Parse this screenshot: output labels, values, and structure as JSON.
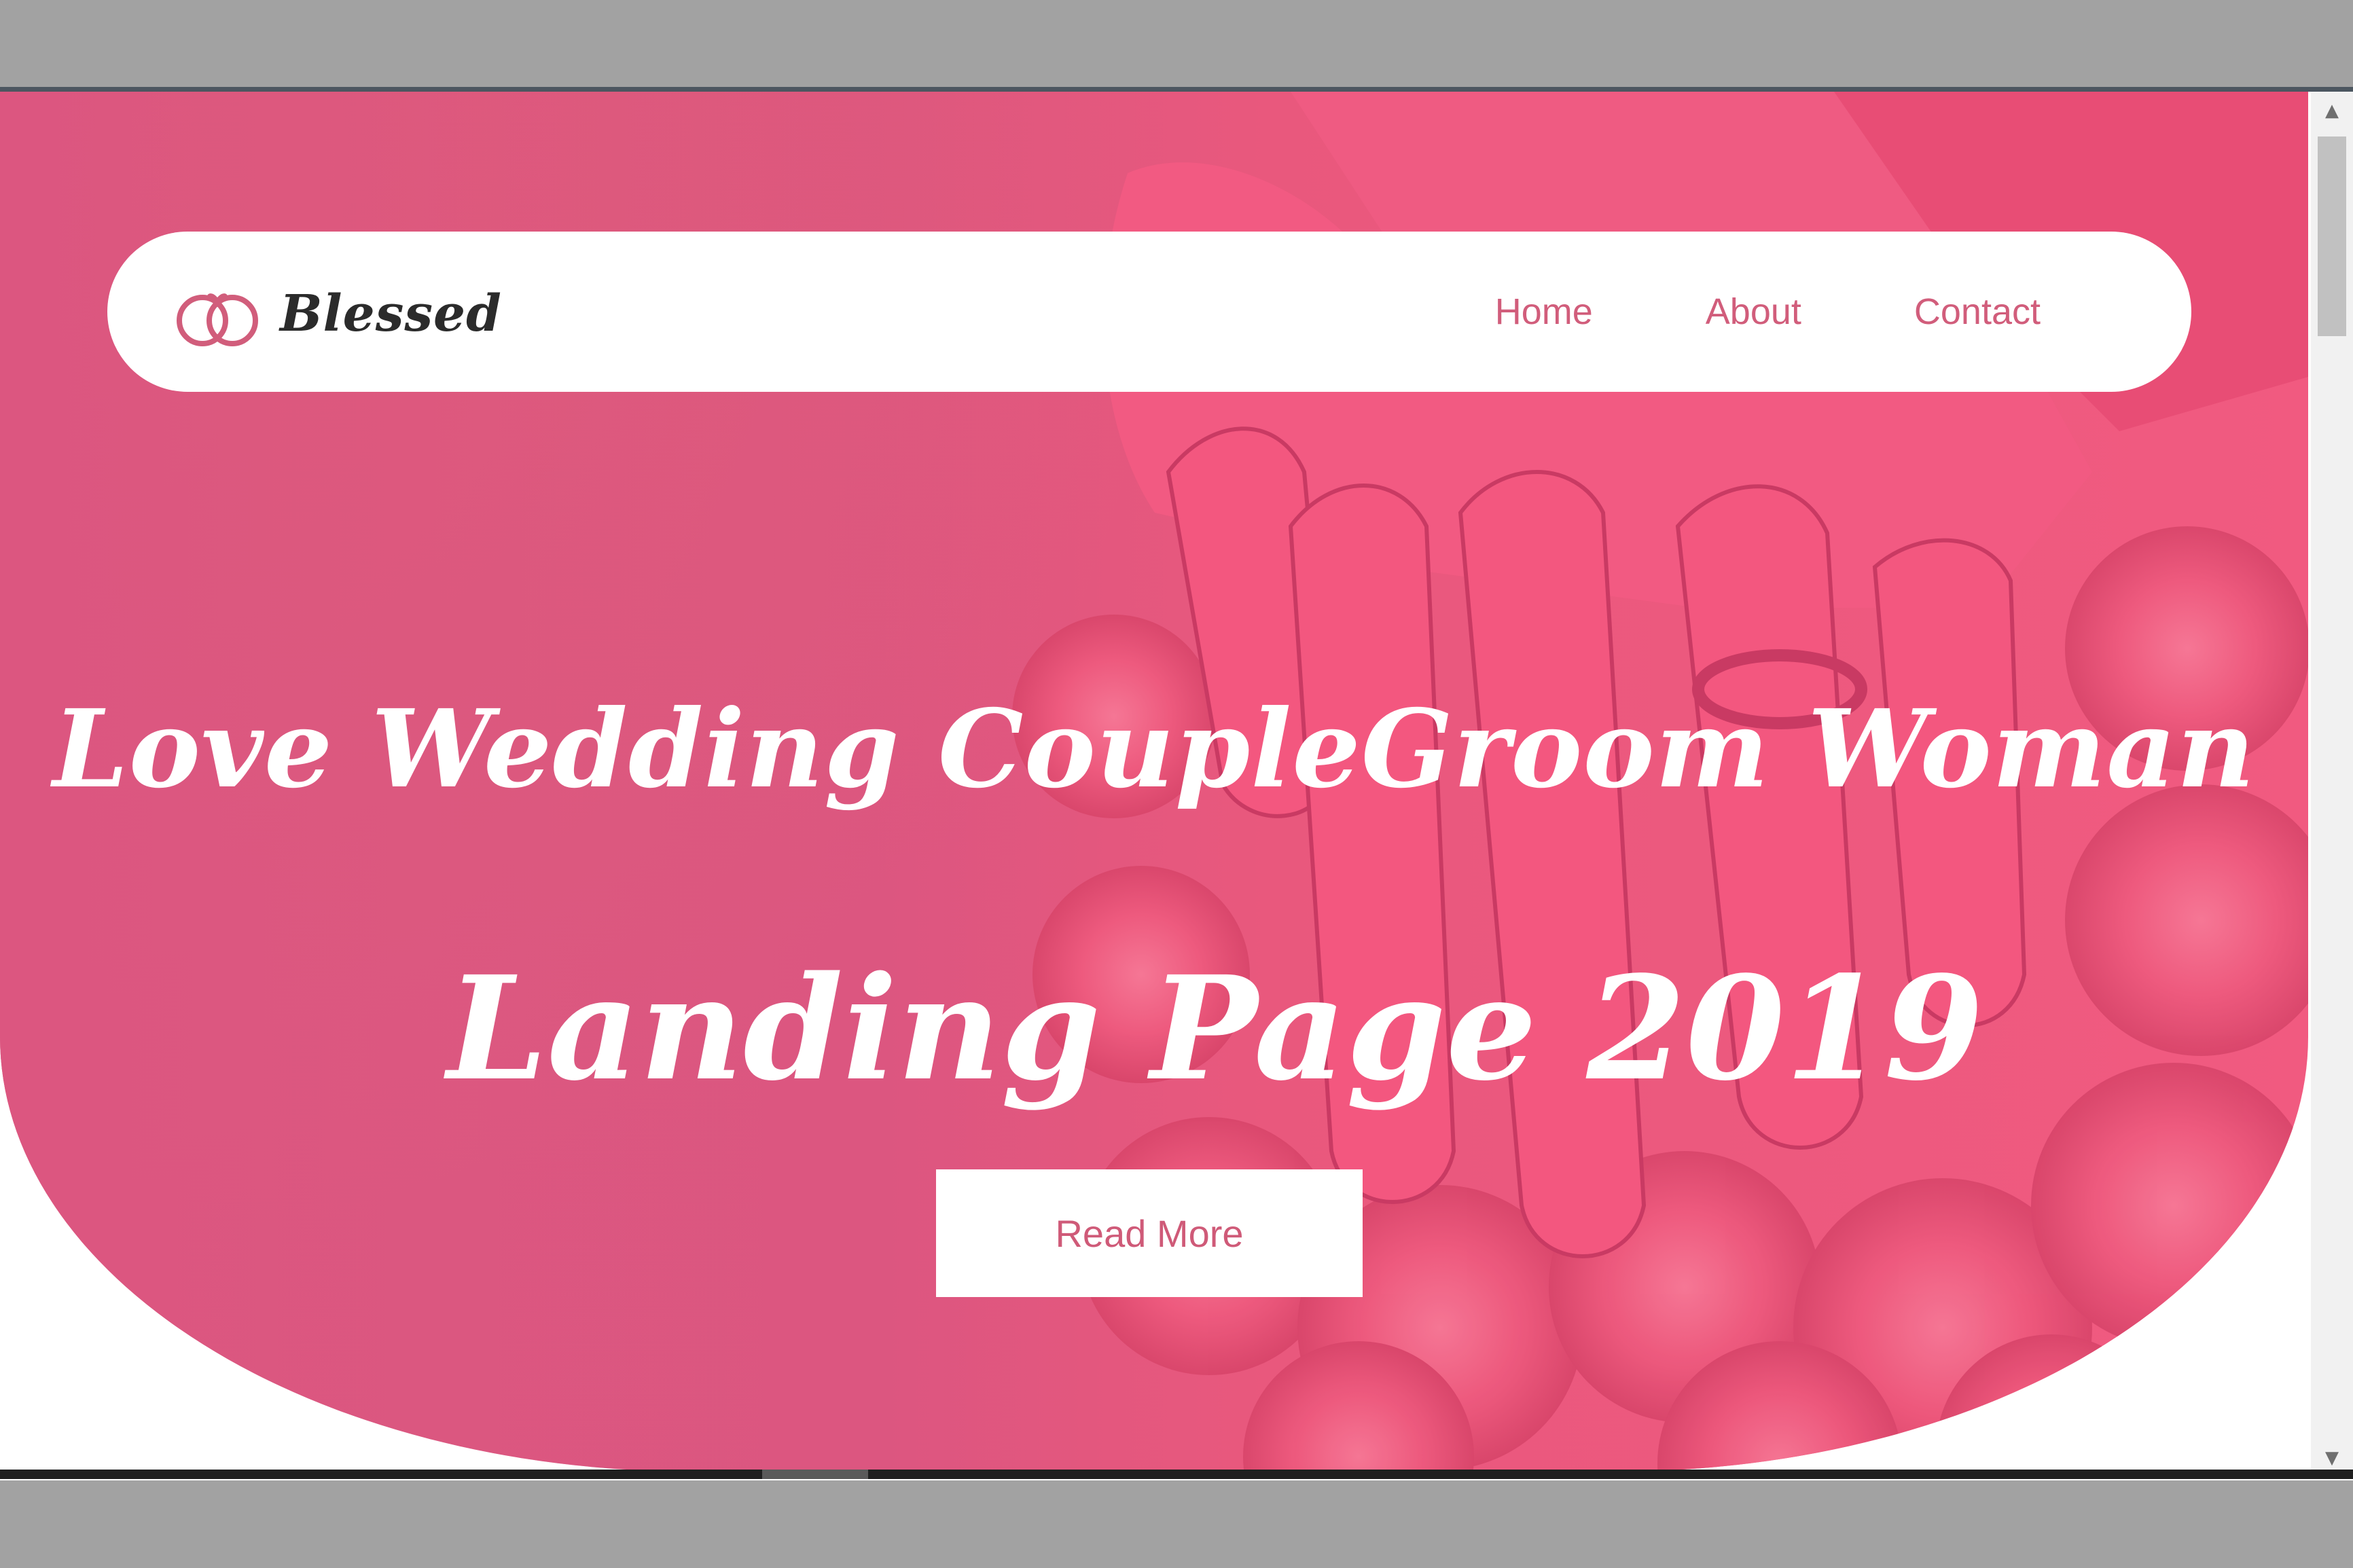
{
  "brand": {
    "name": "Blessed",
    "logo_icon": "wedding-rings-icon"
  },
  "nav": {
    "items": [
      {
        "label": "Home"
      },
      {
        "label": "About"
      },
      {
        "label": "Contact"
      }
    ]
  },
  "hero": {
    "headline_line1": "Love Wedding CoupleGroom Woman",
    "headline_line2": "Landing Page 2019",
    "cta_label": "Read More",
    "background_image": "hands-with-rings-on-rose-bouquet"
  },
  "colors": {
    "accent": "#d15d7b",
    "hero_pink": "#dc5680",
    "hero_pink_right": "#f15a80",
    "white": "#ffffff"
  },
  "browser": {
    "scroll_up_icon": "scroll-up-arrow-icon",
    "scroll_down_icon": "scroll-down-arrow-icon"
  }
}
